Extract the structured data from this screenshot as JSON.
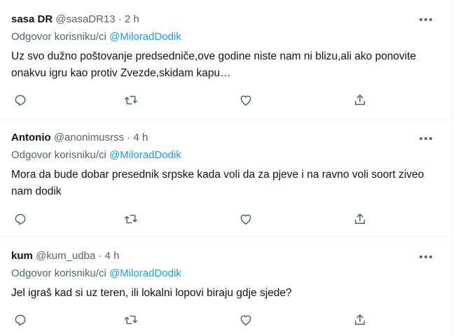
{
  "tweets": [
    {
      "name": "sasa DR",
      "handle": "@sasaDR13",
      "dot": "·",
      "time": "2 h",
      "replying_prefix": "Odgovor korisniku/ci ",
      "replying_to": "@MiloradDodik",
      "text": "Uz svo dužno poštovanje predsedniče,ove godine niste nam ni blizu,ali ako ponovite onakvu igru kao protiv Zvezde,skidam kapu…"
    },
    {
      "name": "Antonio",
      "handle": "@anonimusrss",
      "dot": "·",
      "time": "4 h",
      "replying_prefix": "Odgovor korisniku/ci ",
      "replying_to": "@MiloradDodik",
      "text": "Mora da bude dobar presednik srpske kada voli da za pjeve i na ravno voli soort ziveo nam dodik"
    },
    {
      "name": "kum",
      "handle": "@kum_udba",
      "dot": "·",
      "time": "4 h",
      "replying_prefix": "Odgovor korisniku/ci ",
      "replying_to": "@MiloradDodik",
      "text": "Jel igraš kad si uz teren, ili lokalni lopovi biraju gdje sjede?"
    }
  ],
  "icons": {
    "more": "more-icon",
    "reply": "reply-icon",
    "retweet": "retweet-icon",
    "like": "like-icon",
    "share": "share-icon"
  },
  "colors": {
    "text": "#0f1419",
    "secondary": "#536471",
    "link": "#1d9bf0",
    "divider": "#eff3f4"
  }
}
